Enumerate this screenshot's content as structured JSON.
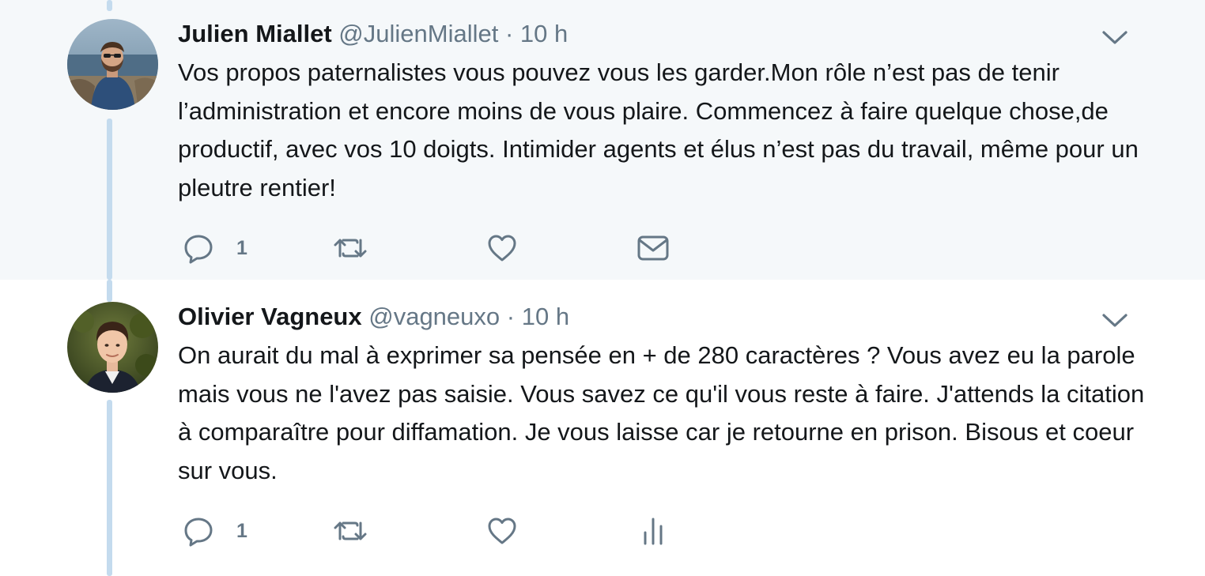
{
  "tweets": [
    {
      "name": "Julien Miallet",
      "handle": "@JulienMiallet",
      "separator": "·",
      "time": "10 h",
      "text": "Vos propos paternalistes vous pouvez vous les garder.Mon rôle n’est pas de tenir l’administration et encore moins de vous plaire. Commencez à faire quelque chose,de productif, avec vos 10 doigts. Intimider agents et élus n’est pas du travail, même pour un pleutre rentier!",
      "reply_count": "1",
      "last_action_icon": "envelope-icon"
    },
    {
      "name": "Olivier Vagneux",
      "handle": "@vagneuxo",
      "separator": "·",
      "time": "10 h",
      "text": "On aurait du mal à exprimer sa pensée en + de 280 caractères ? Vous avez eu la parole mais vous ne l'avez pas saisie. Vous savez ce qu'il vous reste à faire. J'attends la citation à comparaître pour diffamation. Je vous laisse car je retourne en prison. Bisous et coeur sur vous.",
      "reply_count": "1",
      "last_action_icon": "analytics-icon"
    }
  ],
  "colors": {
    "highlight_background": "#f5f8fa",
    "thread_line": "#c4dbee",
    "secondary_text": "#657786",
    "primary_text": "#14171a"
  }
}
